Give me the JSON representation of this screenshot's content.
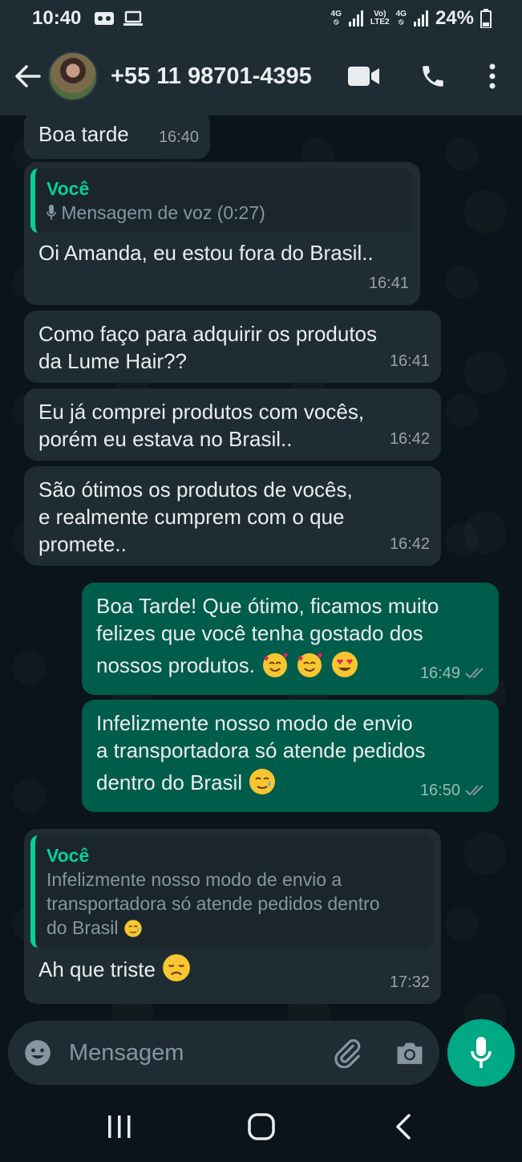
{
  "status_bar": {
    "time": "10:40",
    "net1_top": "4G",
    "net2_top": "Vo)",
    "net2_bottom": "LTE2",
    "net3_top": "4G",
    "battery": "24%"
  },
  "header": {
    "contact_name": "+55 11 98701-4395"
  },
  "messages": [
    {
      "text": "Boa tarde",
      "time": "16:40"
    },
    {
      "quote_author": "Você",
      "quote_text": "Mensagem de voz (0:27)",
      "text": "Oi Amanda, eu estou fora do Brasil..",
      "time": "16:41"
    },
    {
      "line1": "Como faço para adquirir os produtos",
      "line2": "da Lume Hair??",
      "time": "16:41"
    },
    {
      "line1": "Eu já comprei produtos com vocês,",
      "line2": "porém eu estava no Brasil..",
      "time": "16:42"
    },
    {
      "line1": "São ótimos os produtos de vocês,",
      "line2": "e realmente cumprem com o que",
      "line3": "promete..",
      "time": "16:42"
    },
    {
      "line1": "Boa Tarde! Que ótimo, ficamos muito",
      "line2": "felizes que você tenha gostado dos",
      "line3": "nossos produtos.",
      "time": "16:49"
    },
    {
      "line1": "Infelizmente nosso modo de envio",
      "line2": "a transportadora só atende pedidos",
      "line3": "dentro do Brasil",
      "time": "16:50"
    },
    {
      "quote_author": "Você",
      "quote_line1": "Infelizmente nosso modo de envio a",
      "quote_line2": "transportadora só atende pedidos dentro",
      "quote_line3": "do Brasil",
      "text": "Ah que triste",
      "time": "17:32"
    }
  ],
  "composer": {
    "placeholder": "Mensagem"
  },
  "colors": {
    "incoming_bubble": "#202c33",
    "outgoing_bubble": "#005c4b",
    "accent": "#00a884",
    "quote_author": "#06cf9c"
  }
}
